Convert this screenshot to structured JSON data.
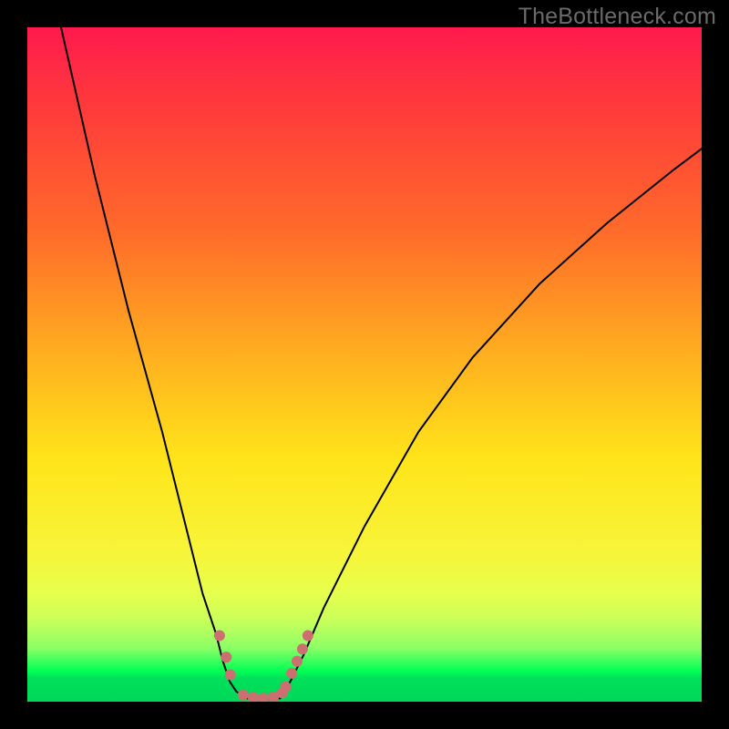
{
  "chart_data": {
    "type": "line",
    "title": "",
    "xlabel": "",
    "ylabel": "",
    "xlim": [
      0,
      100
    ],
    "ylim": [
      0,
      100
    ],
    "background_gradient": {
      "top_color": "#ff1a4d",
      "mid_color": "#ffe41a",
      "bottom_color": "#00d85a"
    },
    "series": [
      {
        "name": "bottleneck-curve-left",
        "stroke": "#000000",
        "stroke_width": 2,
        "x": [
          5,
          10,
          15,
          20,
          24,
          26,
          28,
          29,
          30,
          31,
          32.5
        ],
        "y": [
          100,
          78,
          58,
          40,
          24,
          16,
          10,
          6,
          3,
          1.5,
          0.5
        ]
      },
      {
        "name": "bottleneck-curve-right",
        "stroke": "#000000",
        "stroke_width": 2,
        "x": [
          37.5,
          39,
          41,
          44,
          50,
          58,
          66,
          76,
          86,
          96,
          100
        ],
        "y": [
          0.5,
          3,
          7,
          14,
          26,
          40,
          51,
          62,
          71,
          79,
          82
        ]
      },
      {
        "name": "bottleneck-curve-bottom-flat",
        "stroke": "#000000",
        "stroke_width": 2,
        "x": [
          32.5,
          35,
          37.5
        ],
        "y": [
          0.5,
          0.3,
          0.5
        ]
      },
      {
        "name": "highlight-markers-left",
        "type": "scatter",
        "marker_color": "#cc6f70",
        "marker_size": 12,
        "x": [
          28.5,
          29.5,
          30.1
        ],
        "y": [
          9.8,
          6.6,
          4.0
        ]
      },
      {
        "name": "highlight-markers-bottom",
        "type": "scatter",
        "marker_color": "#cc6f70",
        "marker_size": 12,
        "x": [
          32.0,
          33.5,
          35.0,
          36.5,
          37.8
        ],
        "y": [
          1.0,
          0.6,
          0.5,
          0.7,
          1.3
        ]
      },
      {
        "name": "highlight-markers-right",
        "type": "scatter",
        "marker_color": "#cc6f70",
        "marker_size": 12,
        "x": [
          38.3,
          39.2,
          40.0,
          40.8,
          41.6
        ],
        "y": [
          2.2,
          4.2,
          6.0,
          7.8,
          9.8
        ]
      }
    ]
  },
  "watermark": "TheBottleneck.com",
  "colors": {
    "background": "#000000",
    "watermark": "#6a6a6a",
    "curve": "#000000",
    "marker": "#cc6f70"
  }
}
